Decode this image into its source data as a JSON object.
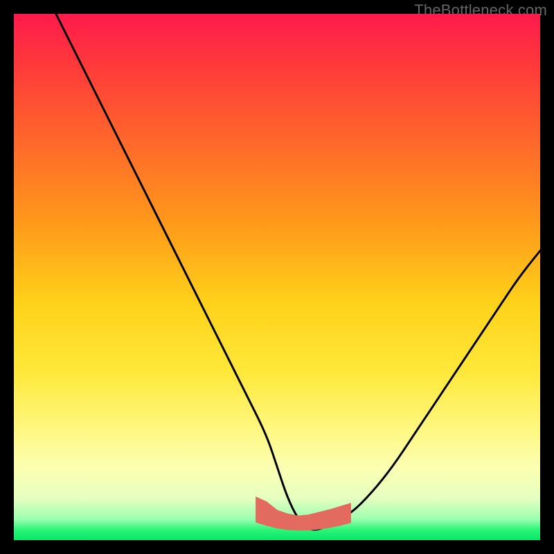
{
  "watermark": "TheBottleneck.com",
  "chart_data": {
    "type": "line",
    "title": "",
    "xlabel": "",
    "ylabel": "",
    "xlim": [
      0,
      100
    ],
    "ylim": [
      0,
      100
    ],
    "grid": false,
    "legend": false,
    "curve": {
      "name": "bottleneck-curve",
      "x": [
        8,
        12,
        16,
        20,
        24,
        28,
        32,
        36,
        40,
        44,
        48,
        50,
        52,
        54,
        56,
        58,
        60,
        64,
        68,
        72,
        76,
        80,
        84,
        88,
        92,
        96,
        100
      ],
      "y": [
        100,
        92,
        84,
        76,
        68,
        60,
        52,
        44,
        36,
        28,
        20,
        14,
        8,
        4,
        2,
        2,
        3,
        5,
        9,
        14,
        20,
        26,
        32,
        38,
        44,
        50,
        55
      ]
    },
    "highlight_band": {
      "name": "optimal-range",
      "x": [
        46,
        48,
        50,
        52,
        54,
        56,
        58,
        60,
        62,
        64
      ],
      "y_top": [
        8.2,
        7.3,
        5.7,
        5.0,
        4.6,
        4.8,
        5.3,
        5.8,
        6.4,
        7.0
      ],
      "y_bot": [
        3.4,
        2.8,
        2.3,
        2.0,
        1.9,
        1.9,
        2.1,
        2.4,
        2.8,
        3.3
      ],
      "color": "#e26a5f"
    },
    "background_gradient": {
      "stops": [
        {
          "pos": 0.0,
          "color": "#ff1a4d"
        },
        {
          "pos": 0.1,
          "color": "#ff3a3a"
        },
        {
          "pos": 0.25,
          "color": "#ff6a2a"
        },
        {
          "pos": 0.4,
          "color": "#ff9a1a"
        },
        {
          "pos": 0.55,
          "color": "#ffd21a"
        },
        {
          "pos": 0.68,
          "color": "#ffe83a"
        },
        {
          "pos": 0.78,
          "color": "#fff67a"
        },
        {
          "pos": 0.86,
          "color": "#fcffb0"
        },
        {
          "pos": 0.92,
          "color": "#e6ffc0"
        },
        {
          "pos": 0.96,
          "color": "#9cffb0"
        },
        {
          "pos": 0.98,
          "color": "#2cf579"
        },
        {
          "pos": 1.0,
          "color": "#06e86a"
        }
      ]
    }
  }
}
